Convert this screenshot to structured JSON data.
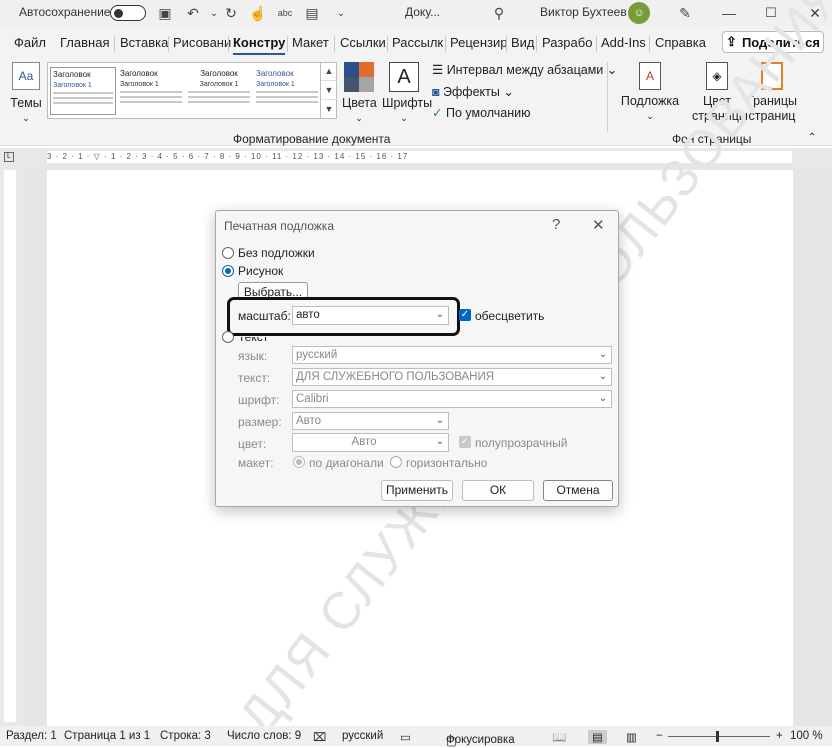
{
  "titlebar": {
    "autosave_label": "Автосохранение",
    "doc_name": "Доку...",
    "user_name": "Виктор Бухтеев"
  },
  "tabs": [
    "Файл",
    "Главная",
    "Вставка",
    "Рисовани",
    "Констру",
    "Макет",
    "Ссылки",
    "Рассылк",
    "Рецензир",
    "Вид",
    "Разрабо",
    "Add-Ins",
    "Справка"
  ],
  "active_tab": "Констру",
  "share_label": "Поделиться",
  "ribbon": {
    "themes_label": "Темы",
    "gallery_items": [
      {
        "heading": "Заголовок",
        "sub": "Заголовок 1"
      },
      {
        "heading": "Заголовок",
        "sub": "Заголовок 1"
      },
      {
        "heading": "Заголовок",
        "sub": "Заголовок 1"
      },
      {
        "heading": "Заголовок",
        "sub": "Заголовок 1"
      }
    ],
    "colors_label": "Цвета",
    "fonts_label": "Шрифты",
    "paragraph_spacing": "Интервал между абзацами",
    "effects": "Эффекты",
    "default": "По умолчанию",
    "group_format": "Форматирование документа",
    "watermark": "Подложка",
    "page_color": "Цвет страницы",
    "page_borders": "Границы страниц",
    "group_background": "Фон страницы"
  },
  "ruler_text": "3 · 2 · 1 · ▽ · 1 · 2 · 3 · 4 · 5 · 6 · 7 · 8 · 9 · 10 · 11 · 12 · 13 · 14 · 15 · 16 · 17",
  "watermark_text": "ДЛЯ СЛУЖЕБНОГО ПОЛЬЗОВАНИЯ",
  "dialog": {
    "title": "Печатная подложка",
    "help": "?",
    "close": "✕",
    "no_watermark": "Без подложки",
    "picture": "Рисунок",
    "choose_btn": "Выбрать...",
    "scale_label": "масштаб:",
    "scale_value": "авто",
    "washout_label": "обесцветить",
    "text_option": "Текст",
    "language_label": "язык:",
    "language_value": "русский",
    "text_label": "текст:",
    "text_value": "ДЛЯ СЛУЖЕБНОГО ПОЛЬЗОВАНИЯ",
    "font_label": "шрифт:",
    "font_value": "Calibri",
    "size_label": "размер:",
    "size_value": "Авто",
    "color_label": "цвет:",
    "color_value": "Авто",
    "semitransparent": "полупрозрачный",
    "layout_label": "макет:",
    "diagonal": "по диагонали",
    "horizontal": "горизонтально",
    "apply_btn": "Применить",
    "ok_btn": "ОК",
    "cancel_btn": "Отмена"
  },
  "status": {
    "section": "Раздел: 1",
    "page": "Страница 1 из 1",
    "line": "Строка: 3",
    "words": "Число слов: 9",
    "language": "русский",
    "focus": "Фокусировка",
    "zoom": "100 %"
  }
}
